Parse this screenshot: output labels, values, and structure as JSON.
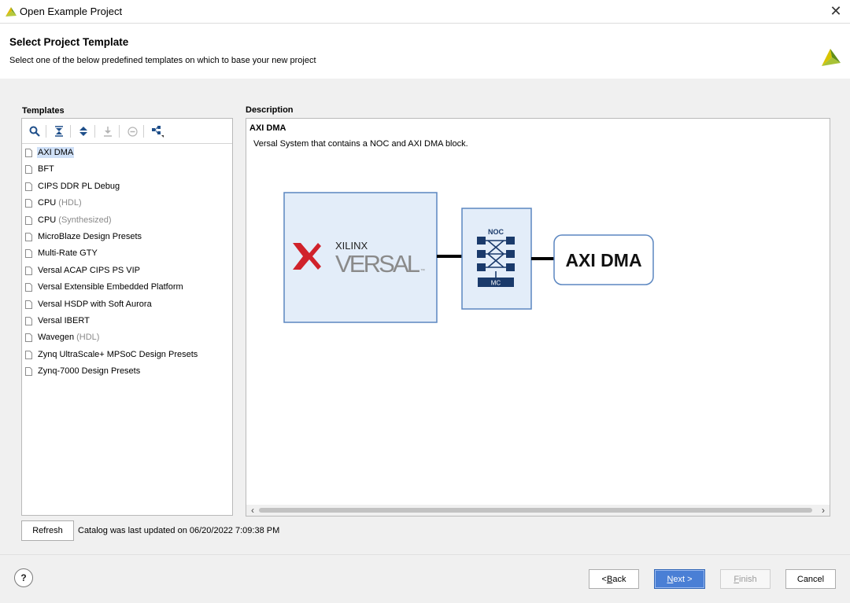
{
  "window": {
    "title": "Open Example Project",
    "close_icon": "close-icon"
  },
  "header": {
    "title": "Select Project Template",
    "subtitle": "Select one of the below predefined templates on which to base your new project"
  },
  "templates": {
    "label": "Templates",
    "toolbar_icons": [
      "search-icon",
      "collapse-all-icon",
      "expand-all-icon",
      "download-icon",
      "remove-icon",
      "hierarchy-icon"
    ],
    "items": [
      {
        "label": "AXI DMA",
        "suffix": "",
        "selected": true
      },
      {
        "label": "BFT",
        "suffix": ""
      },
      {
        "label": "CIPS DDR PL Debug",
        "suffix": ""
      },
      {
        "label": "CPU",
        "suffix": "(HDL)"
      },
      {
        "label": "CPU",
        "suffix": "(Synthesized)"
      },
      {
        "label": "MicroBlaze Design Presets",
        "suffix": ""
      },
      {
        "label": "Multi-Rate GTY",
        "suffix": ""
      },
      {
        "label": "Versal ACAP CIPS PS VIP",
        "suffix": ""
      },
      {
        "label": "Versal Extensible Embedded Platform",
        "suffix": ""
      },
      {
        "label": "Versal HSDP with Soft Aurora",
        "suffix": ""
      },
      {
        "label": "Versal IBERT",
        "suffix": ""
      },
      {
        "label": "Wavegen",
        "suffix": "(HDL)"
      },
      {
        "label": "Zynq UltraScale+ MPSoC Design Presets",
        "suffix": ""
      },
      {
        "label": "Zynq-7000 Design Presets",
        "suffix": ""
      }
    ]
  },
  "description": {
    "label": "Description",
    "title": "AXI DMA",
    "text": "Versal System that contains a NOC and AXI DMA block.",
    "diagram": {
      "xilinx": "XILINX",
      "versal": "VERSAL",
      "tm": "™",
      "noc": "NOC",
      "mc": "MC",
      "dma": "AXI DMA"
    }
  },
  "refresh_label": "Refresh",
  "catalog_text": "Catalog was last updated on 06/20/2022 7:09:38 PM",
  "footer": {
    "help": "?",
    "back_mn": "B",
    "back_pre": "< ",
    "back_post": "ack",
    "next_mn": "N",
    "next_post": "ext >",
    "finish_mn": "F",
    "finish_post": "inish",
    "cancel": "Cancel"
  },
  "colors": {
    "accent": "#4a7fd5",
    "selection": "#cfe0f7",
    "versal_block": "#e3edf9",
    "xilinx_red": "#d0222b",
    "noc_navy": "#1a3a6b"
  }
}
